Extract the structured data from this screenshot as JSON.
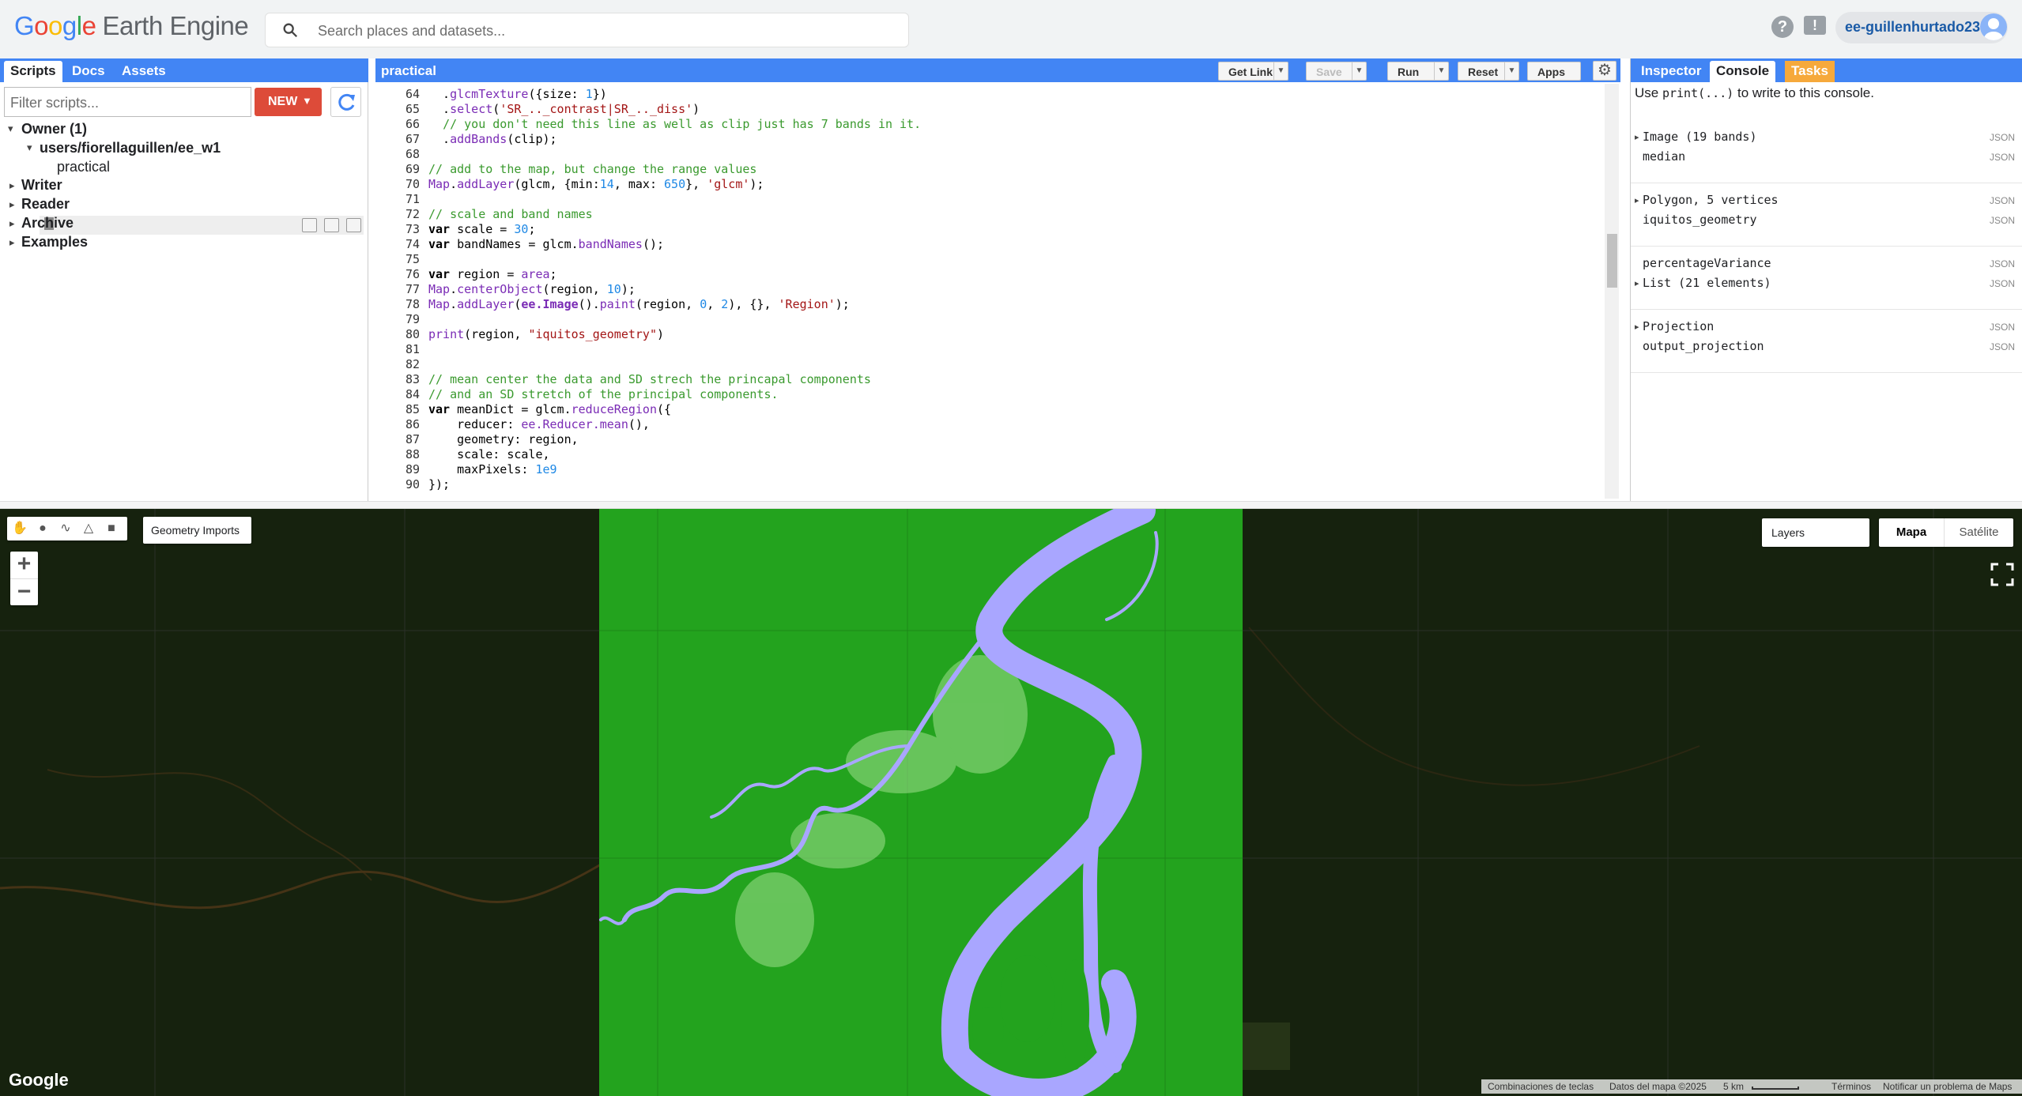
{
  "header": {
    "logo_google": [
      "G",
      "o",
      "o",
      "g",
      "l",
      "e"
    ],
    "logo_product": "Earth Engine",
    "search_placeholder": "Search places and datasets...",
    "help_label": "?",
    "feedback_label": "!",
    "account": "ee-guillenhurtado23"
  },
  "left_panel": {
    "tabs": [
      "Scripts",
      "Docs",
      "Assets"
    ],
    "filter_placeholder": "Filter scripts...",
    "new_button": "NEW",
    "tree": {
      "owner": "Owner (1)",
      "repo": "users/fiorellaguillen/ee_w1",
      "file": "practical",
      "writer": "Writer",
      "reader": "Reader",
      "archive": "Archive",
      "examples": "Examples"
    }
  },
  "editor": {
    "title": "practical",
    "buttons": {
      "get_link": "Get Link",
      "save": "Save",
      "run": "Run",
      "reset": "Reset",
      "apps": "Apps"
    },
    "lines": [
      {
        "n": "64",
        "html": "  .<span class='c-fn'>glcmTexture</span>({size: <span class='c-num'>1</span>})"
      },
      {
        "n": "65",
        "html": "  .<span class='c-fn'>select</span>(<span class='c-str'>'SR_.._contrast|SR_.._diss'</span>)"
      },
      {
        "n": "66",
        "html": "  <span class='c-cm'>// you don't need this line as well as clip just has 7 bands in it.</span>"
      },
      {
        "n": "67",
        "html": "  .<span class='c-fn'>addBands</span>(clip);"
      },
      {
        "n": "68",
        "html": ""
      },
      {
        "n": "69",
        "html": "<span class='c-cm'>// add to the map, but change the range values</span>"
      },
      {
        "n": "70",
        "html": "<span class='c-fn'>Map</span>.<span class='c-fn'>addLayer</span>(glcm, {min:<span class='c-num'>14</span>, max: <span class='c-num'>650</span>}, <span class='c-str'>'glcm'</span>);"
      },
      {
        "n": "71",
        "html": ""
      },
      {
        "n": "72",
        "html": "<span class='c-cm'>// scale and band names</span>"
      },
      {
        "n": "73",
        "html": "<span class='c-kw'>var</span> scale = <span class='c-num'>30</span>;"
      },
      {
        "n": "74",
        "html": "<span class='c-kw'>var</span> bandNames = glcm.<span class='c-fn'>bandNames</span>();"
      },
      {
        "n": "75",
        "html": ""
      },
      {
        "n": "76",
        "html": "<span class='c-kw'>var</span> region = <span class='c-fn'>area</span>;"
      },
      {
        "n": "77",
        "html": "<span class='c-fn'>Map</span>.<span class='c-fn'>centerObject</span>(region, <span class='c-num'>10</span>);"
      },
      {
        "n": "78",
        "html": "<span class='c-fn'>Map</span>.<span class='c-fn'>addLayer</span>(<span class='c-cls'>ee.Image</span>().<span class='c-fn'>paint</span>(region, <span class='c-num'>0</span>, <span class='c-num'>2</span>), {}, <span class='c-str'>'Region'</span>);"
      },
      {
        "n": "79",
        "html": ""
      },
      {
        "n": "80",
        "html": "<span class='c-fn'>print</span>(region, <span class='c-str'>\"iquitos_geometry\"</span>)"
      },
      {
        "n": "81",
        "html": ""
      },
      {
        "n": "82",
        "html": ""
      },
      {
        "n": "83",
        "html": "<span class='c-cm'>// mean center the data and SD strech the princapal components</span>"
      },
      {
        "n": "84",
        "html": "<span class='c-cm'>// and an SD stretch of the principal components.</span>"
      },
      {
        "n": "85",
        "html": "<span class='c-kw'>var</span> meanDict = glcm.<span class='c-fn'>reduceRegion</span>({"
      },
      {
        "n": "86",
        "html": "    reducer: <span class='c-fn'>ee.Reducer.mean</span>(),"
      },
      {
        "n": "87",
        "html": "    geometry: region,"
      },
      {
        "n": "88",
        "html": "    scale: scale,"
      },
      {
        "n": "89",
        "html": "    maxPixels: <span class='c-num'>1e9</span>"
      },
      {
        "n": "90",
        "html": "});"
      }
    ]
  },
  "right_panel": {
    "tabs": [
      "Inspector",
      "Console",
      "Tasks"
    ],
    "console_hint_pre": "Use ",
    "console_hint_code": "print(...)",
    "console_hint_post": " to write to this console.",
    "json_label": "JSON",
    "entries": [
      {
        "type": "Image (19 bands)",
        "name": "median"
      },
      {
        "type": "Polygon, 5 vertices",
        "name": "iquitos_geometry"
      },
      {
        "type": "List (21 elements)",
        "name": "percentageVariance"
      },
      {
        "type": "Projection",
        "name": "output_projection"
      }
    ]
  },
  "map": {
    "geometry_imports": "Geometry Imports",
    "layers": "Layers",
    "map_type_map": "Mapa",
    "map_type_sat": "Satélite",
    "zoom_in": "+",
    "zoom_out": "−",
    "google": "Google",
    "attribution": {
      "shortcuts": "Combinaciones de teclas",
      "data": "Datos del mapa ©2025",
      "scale": "5 km",
      "terms": "Términos",
      "report": "Notificar un problema de Maps"
    }
  },
  "colors": {
    "accent_blue": "#4285f4",
    "new_button_red": "#dd4b39",
    "tasks_orange": "#f6a93b",
    "layer_green": "#23a31e",
    "river_lavender": "#a9a6ff"
  }
}
